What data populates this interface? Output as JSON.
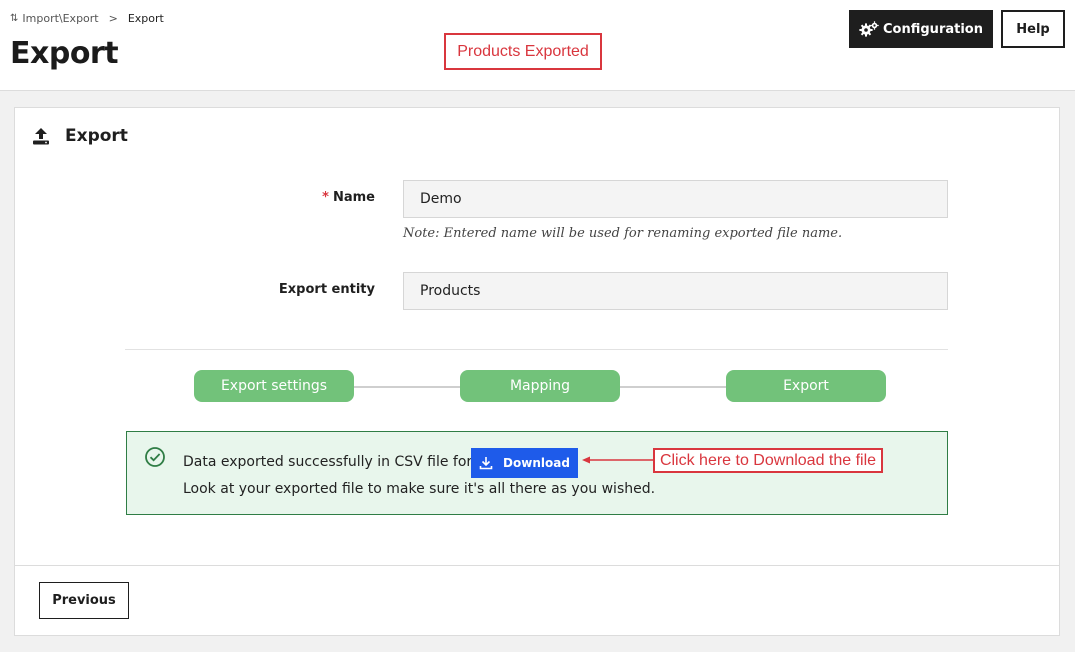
{
  "breadcrumb": {
    "parent": "Import\\Export",
    "separator": ">",
    "current": "Export"
  },
  "page_title": "Export",
  "annotations": {
    "top_label": "Products Exported",
    "download_label": "Click here to Download the file",
    "color": "#d9363e"
  },
  "header_buttons": {
    "configuration": "Configuration",
    "help": "Help"
  },
  "card": {
    "title": "Export"
  },
  "form": {
    "name_required_mark": "*",
    "name_label": "Name",
    "name_value": "Demo",
    "name_note": "Note: Entered name will be used for renaming exported file name.",
    "entity_label": "Export entity",
    "entity_value": "Products"
  },
  "steps": [
    {
      "label": "Export settings"
    },
    {
      "label": "Mapping"
    },
    {
      "label": "Export"
    }
  ],
  "success": {
    "message_line1": "Data exported successfully in CSV file format.",
    "download_label": "Download",
    "message_line2": "Look at your exported file to make sure it's all there as you wished."
  },
  "footer": {
    "previous_label": "Previous"
  },
  "colors": {
    "accent_green": "#72c27a",
    "download_blue": "#1e5bea",
    "dark_button": "#1e1e1e",
    "success_bg": "#e8f6ec"
  }
}
